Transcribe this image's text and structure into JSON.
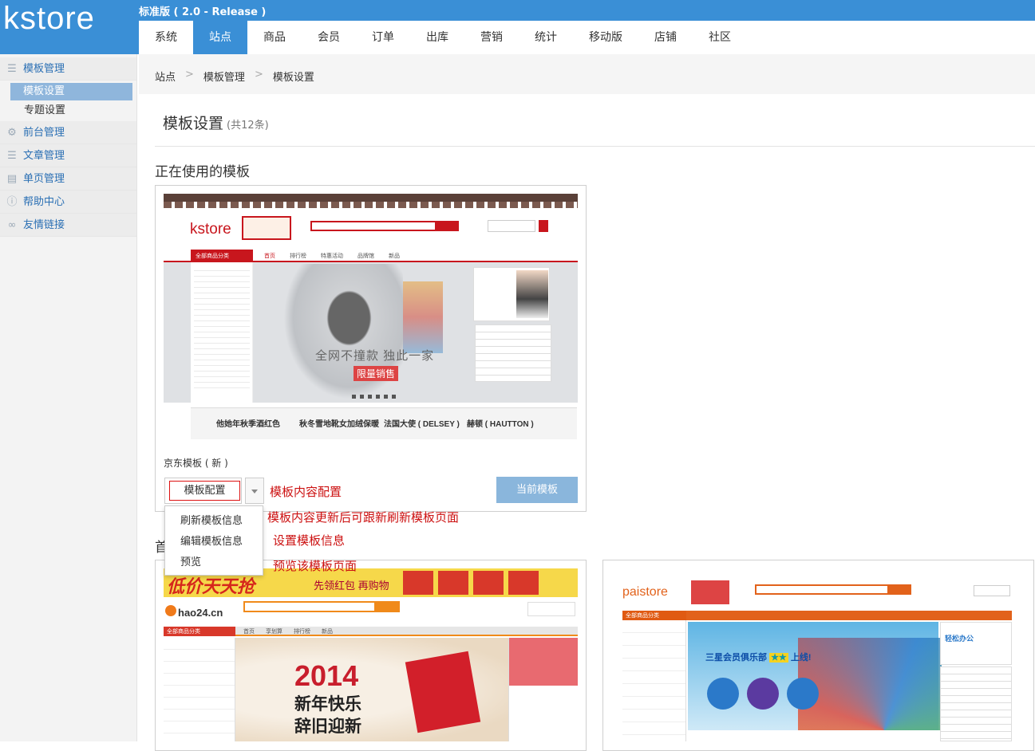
{
  "header": {
    "logo": "kstore",
    "version": "标准版 ( 2.0 - Release )",
    "nav": [
      "系统",
      "站点",
      "商品",
      "会员",
      "订单",
      "出库",
      "营销",
      "统计",
      "移动版",
      "店铺",
      "社区"
    ],
    "active_nav": "站点",
    "colors": {
      "primary": "#3a8fd6"
    }
  },
  "sidebar": {
    "groups": [
      {
        "label": "模板管理",
        "icon": "list-icon"
      },
      {
        "label": "前台管理",
        "icon": "gear-icon"
      },
      {
        "label": "文章管理",
        "icon": "article-icon"
      },
      {
        "label": "单页管理",
        "icon": "page-icon"
      },
      {
        "label": "帮助中心",
        "icon": "info-icon"
      },
      {
        "label": "友情链接",
        "icon": "link-icon"
      }
    ],
    "sub": [
      "模板设置",
      "专题设置"
    ]
  },
  "breadcrumb": [
    "站点",
    "模板管理",
    "模板设置"
  ],
  "page": {
    "title": "模板设置",
    "count": "(共12条)",
    "section_current": "正在使用的模板",
    "section_other": "首"
  },
  "current_template": {
    "name": "京东模板 ( 新 )",
    "config_button": "模板配置",
    "current_button": "当前模板",
    "dropdown": [
      "刷新模板信息",
      "编辑模板信息",
      "预览"
    ],
    "thumb": {
      "logo": "kstore",
      "banner": "全网不撞款 独此一家",
      "sale": "限量销售",
      "products": [
        "他她年秋季酒红色",
        "秋冬雪地靴女加绒保暖",
        "法国大使 ( DELSEY )",
        "赫顿 ( HAUTTON )"
      ],
      "category": "全部商品分类",
      "tabs": [
        "首页",
        "排行榜",
        "特惠活动",
        "品牌馆",
        "新品"
      ]
    }
  },
  "annotations": [
    "模板内容配置",
    "模板内容更新后可跟新刷新模板页面",
    "设置模板信息",
    "预览该模板页面"
  ],
  "other_templates": [
    {
      "promo": "低价天天抢",
      "promo_sub": "先领红包 再购物",
      "logo": "hao24.cn",
      "banner_year": "2014",
      "banner_line1": "新年快乐",
      "banner_line2": "辞旧迎新",
      "category": "全部商品分类",
      "tabs": [
        "首页",
        "享划算",
        "排行榜",
        "新品"
      ]
    },
    {
      "logo": "paistore",
      "banner": "三星会员俱乐部",
      "banner_end": "上线!",
      "side_title": "轻松办公",
      "category": "全部商品分类"
    }
  ]
}
